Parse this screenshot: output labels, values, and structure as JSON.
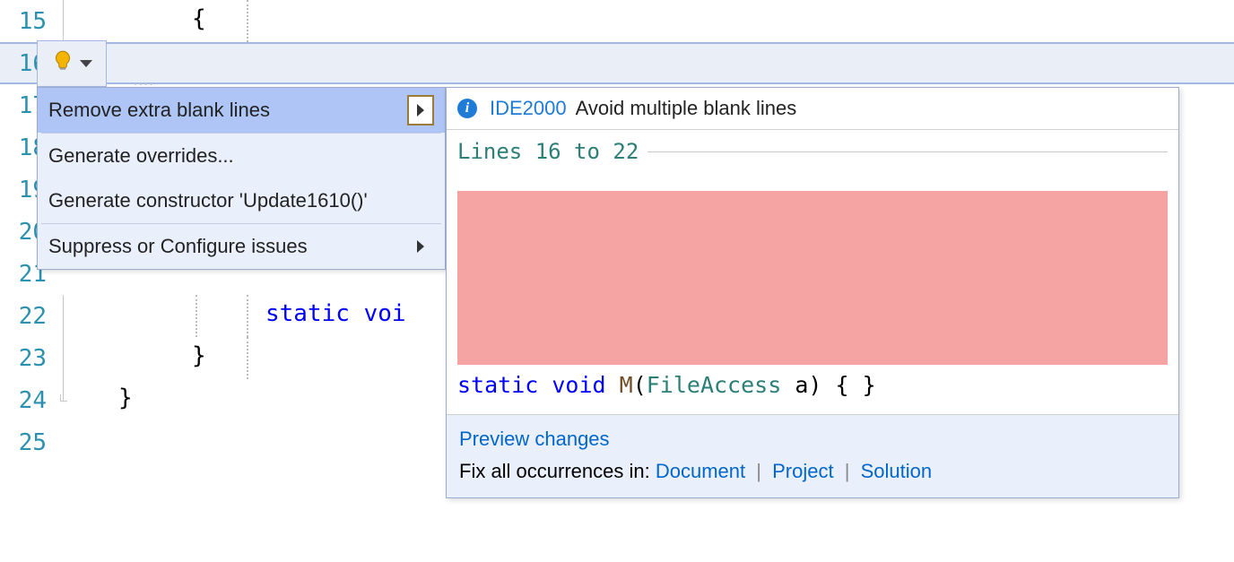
{
  "editor": {
    "line_numbers": [
      "15",
      "16",
      "17",
      "18",
      "19",
      "20",
      "21",
      "22",
      "23",
      "24",
      "25"
    ],
    "code": {
      "brace_open": "{",
      "static_kw": "static",
      "void_kw": "void",
      "tail_void_frag": " voi",
      "brace_close": "}"
    }
  },
  "bulb": {
    "alt": "lightbulb"
  },
  "menu": {
    "items": [
      {
        "label": "Remove extra blank lines",
        "has_submenu": true,
        "selected": true
      },
      {
        "label": "Generate overrides...",
        "has_submenu": false,
        "selected": false
      },
      {
        "label": "Generate constructor 'Update1610()'",
        "has_submenu": false,
        "selected": false
      },
      {
        "label": "Suppress or Configure issues",
        "has_submenu": true,
        "selected": false
      }
    ]
  },
  "preview": {
    "rule_id": "IDE2000",
    "rule_message": "Avoid multiple blank lines",
    "range_label": "Lines 16 to 22",
    "code_static": "static",
    "code_void": " void ",
    "code_method": "M",
    "code_paren_open": "(",
    "code_type": "FileAccess",
    "code_rest": " a) { }",
    "preview_changes": "Preview changes",
    "fix_prefix": "Fix all occurrences in: ",
    "link_document": "Document",
    "link_project": "Project",
    "link_solution": "Solution"
  }
}
